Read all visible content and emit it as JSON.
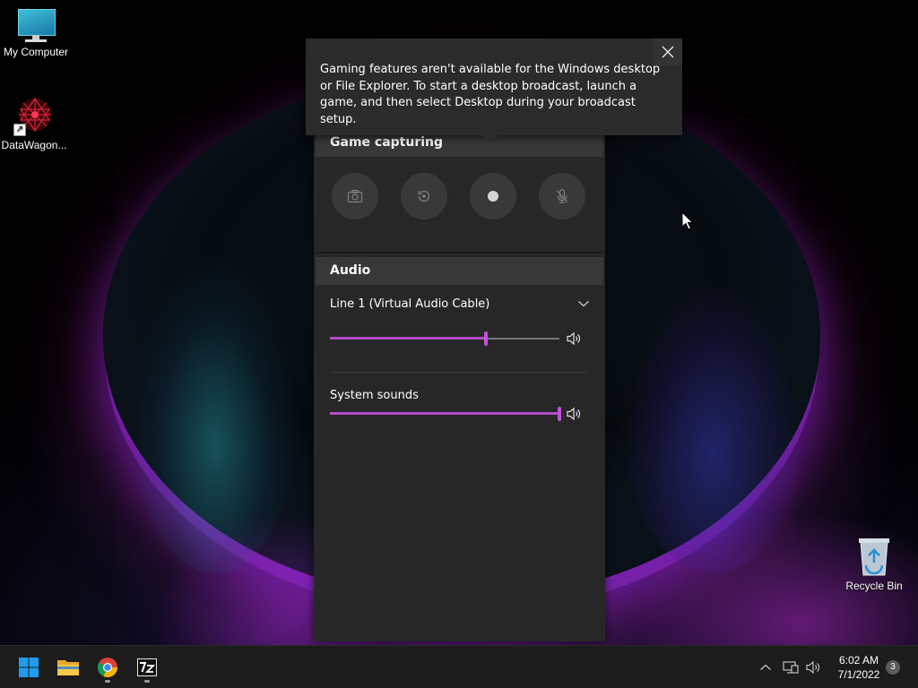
{
  "desktop": {
    "icons": [
      {
        "label": "My Computer"
      },
      {
        "label": "DataWagon..."
      },
      {
        "label": "Recycle Bin"
      }
    ]
  },
  "toast": {
    "message": "Gaming features aren't available for the Windows desktop or File Explorer. To start a desktop broadcast, launch a game, and then select Desktop during your broadcast setup."
  },
  "capture": {
    "header": "Game capturing",
    "buttons": [
      {
        "icon": "camera-icon",
        "state": "disabled"
      },
      {
        "icon": "record-last-icon",
        "state": "disabled"
      },
      {
        "icon": "record-icon",
        "state": "disabled"
      },
      {
        "icon": "mic-off-icon",
        "state": "disabled"
      }
    ]
  },
  "audio": {
    "header": "Audio",
    "device": "Line 1 (Virtual Audio Cable)",
    "device_volume": 0.68,
    "mix_label": "System sounds",
    "system_volume": 1.0
  },
  "taskbar": {
    "apps": [
      {
        "icon": "windows-start-icon",
        "running": false
      },
      {
        "icon": "file-explorer-icon",
        "running": false
      },
      {
        "icon": "chrome-icon",
        "running": true
      },
      {
        "icon": "7zip-icon",
        "running": true
      }
    ],
    "time": "6:02 AM",
    "date": "7/1/2022",
    "notification_count": "3"
  },
  "colors": {
    "accent": "#b04cc8",
    "panel_bg": "#272727",
    "header_bg": "#383838",
    "taskbar_bg": "#1c1c1c"
  }
}
